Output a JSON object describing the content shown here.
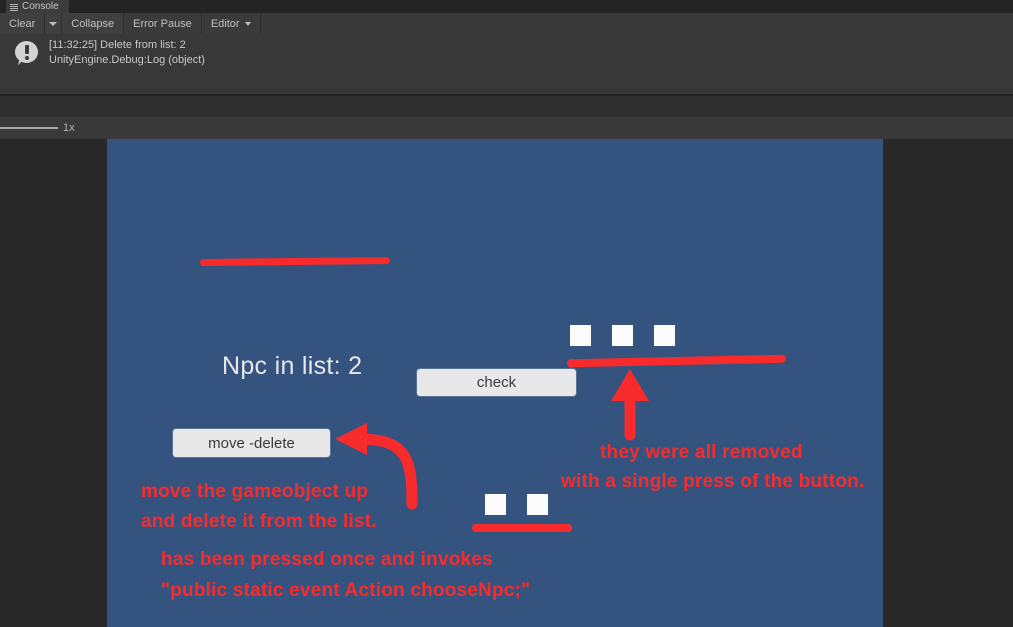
{
  "console": {
    "tab_label": "Console",
    "tab_icon": "list-icon",
    "toolbar": {
      "clear_label": "Clear",
      "clear_dropdown_icon": "chevron-down-icon",
      "collapse_label": "Collapse",
      "error_pause_label": "Error Pause",
      "editor_label": "Editor",
      "editor_dropdown_icon": "chevron-down-icon"
    },
    "log_entry": {
      "icon": "info-log-icon",
      "line1": "[11:32:25] Delete from list: 2",
      "line2": "UnityEngine.Debug:Log (object)"
    }
  },
  "scalebar": {
    "label": "1x",
    "slider_icon": "zoom-slider"
  },
  "game_view": {
    "background_color": "#35537f",
    "npc_count_text": "Npc in list: 2",
    "buttons": [
      {
        "id": "check",
        "label": "check"
      },
      {
        "id": "move-delete",
        "label": "move -delete"
      }
    ],
    "cubes_top_count": 3,
    "cubes_bottom_count": 2
  },
  "annotations": {
    "color": "#f72b2b",
    "move_line1": "move the gameobject up",
    "move_line2": "and delete it from the list.",
    "pressed_line1": "has been pressed once and invokes",
    "pressed_line2": "\"public static event Action chooseNpc;\"",
    "removed_line1": "they were all removed",
    "removed_line2": "with a single press of the button.",
    "arrow_left_icon": "curved-arrow-left-icon",
    "arrow_up_icon": "arrow-up-icon",
    "underline_npc_icon": "underline-stroke",
    "underline_cubes_top_icon": "underline-stroke",
    "underline_cubes_bottom_icon": "underline-stroke"
  }
}
